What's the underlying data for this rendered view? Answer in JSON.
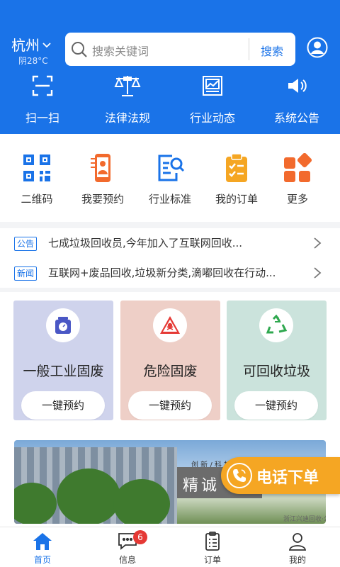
{
  "header": {
    "city": "杭州",
    "weather": "阴28°C",
    "search_placeholder": "搜索关键词",
    "search_button": "搜索",
    "accent_color": "#1a73e8"
  },
  "top_nav": [
    {
      "label": "扫一扫",
      "icon": "scan-icon"
    },
    {
      "label": "法律法规",
      "icon": "scales-icon"
    },
    {
      "label": "行业动态",
      "icon": "trend-chart-icon"
    },
    {
      "label": "系统公告",
      "icon": "speaker-icon"
    }
  ],
  "quick_grid": [
    {
      "label": "二维码",
      "icon": "qrcode-icon"
    },
    {
      "label": "我要预约",
      "icon": "appointment-icon"
    },
    {
      "label": "行业标准",
      "icon": "standard-doc-icon"
    },
    {
      "label": "我的订单",
      "icon": "clipboard-icon"
    },
    {
      "label": "更多",
      "icon": "more-apps-icon"
    }
  ],
  "news": [
    {
      "tag": "公告",
      "text": "七成垃圾回收员,今年加入了互联网回收..."
    },
    {
      "tag": "新闻",
      "text": "互联网+废品回收,垃圾新分类,滴嘟回收在行动..."
    }
  ],
  "categories": [
    {
      "title": "一般工业固废",
      "button": "一键预约",
      "bg": "#cfd3ec",
      "icon": "scale-weight-icon"
    },
    {
      "title": "危险固废",
      "button": "一键预约",
      "bg": "#eecfc7",
      "icon": "hazard-icon"
    },
    {
      "title": "可回收垃圾",
      "button": "一键预约",
      "bg": "#cbe3dc",
      "icon": "recycle-icon"
    }
  ],
  "banner": {
    "board_text": "精诚",
    "small_text": "创 新 / 科 技",
    "footer_text": "浙江兴迪回收·公司"
  },
  "call_button": {
    "label": "电话下单"
  },
  "tabbar": [
    {
      "label": "首页",
      "icon": "home-icon",
      "active": true
    },
    {
      "label": "信息",
      "icon": "message-icon",
      "badge": "6"
    },
    {
      "label": "订单",
      "icon": "order-icon"
    },
    {
      "label": "我的",
      "icon": "profile-icon"
    }
  ]
}
